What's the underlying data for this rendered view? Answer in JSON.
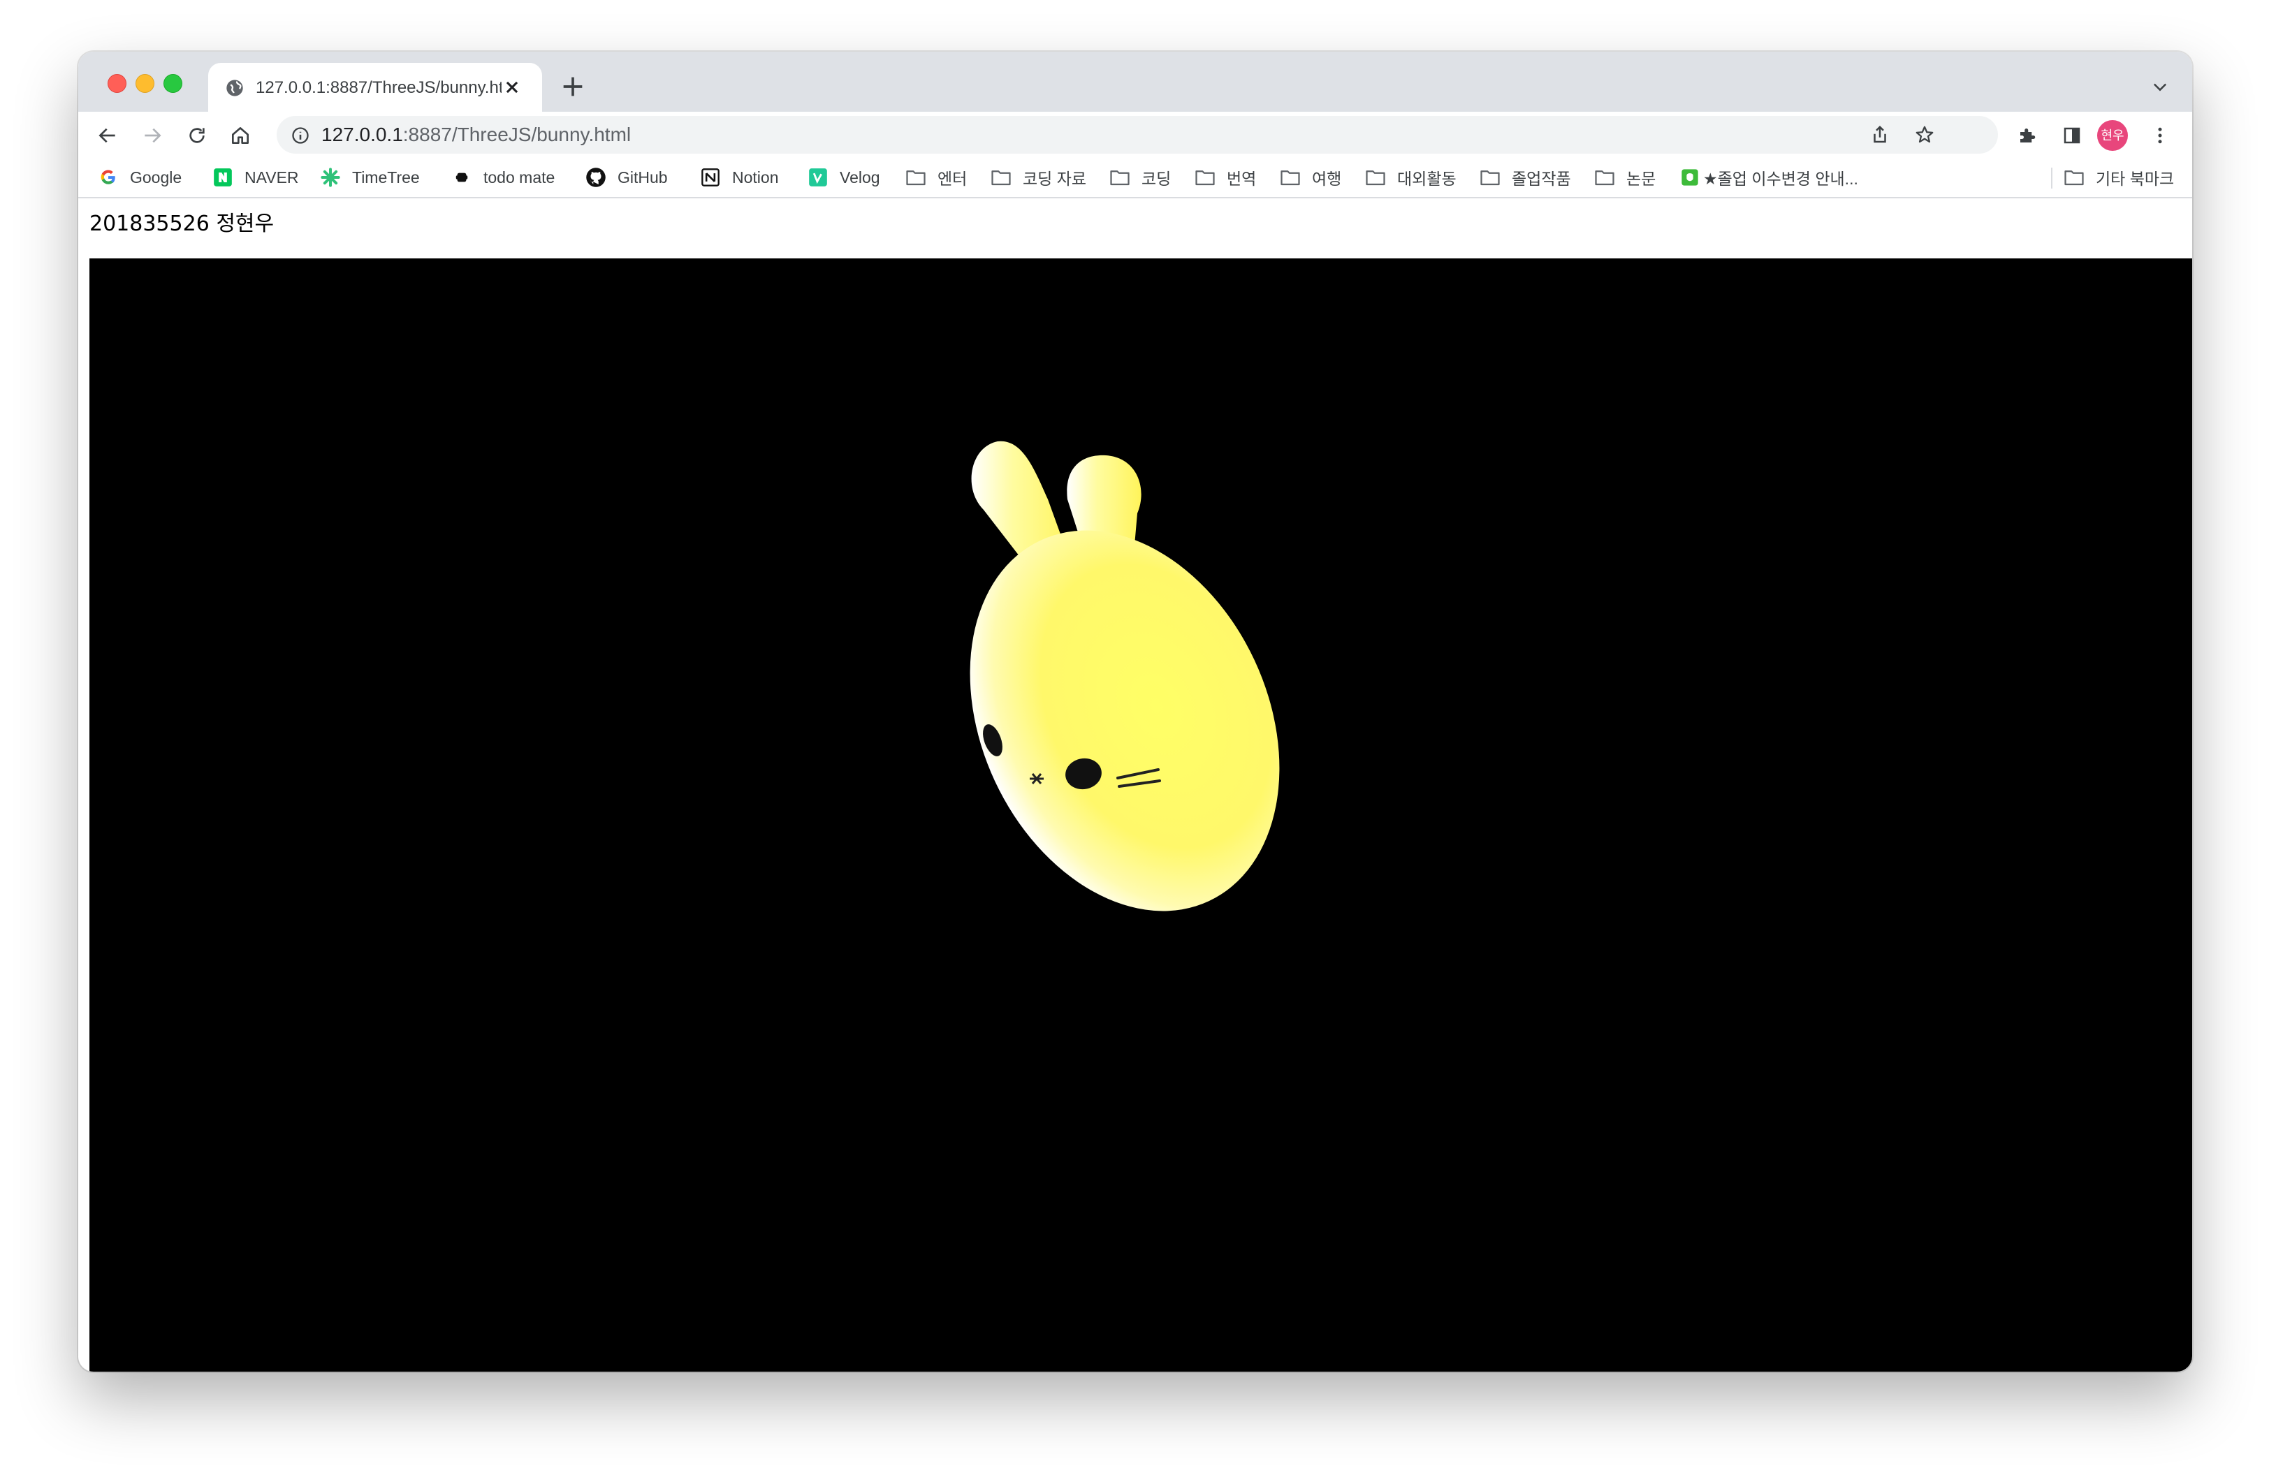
{
  "browser": {
    "tab": {
      "title": "127.0.0.1:8887/ThreeJS/bunny.html",
      "favicon": "globe-icon"
    },
    "address_bar": {
      "host": "127.0.0.1",
      "path": ":8887/ThreeJS/bunny.html"
    },
    "profile_initials": "현우",
    "bookmarks": [
      {
        "label": "Google",
        "icon": "google-icon"
      },
      {
        "label": "NAVER",
        "icon": "naver-icon"
      },
      {
        "label": "TimeTree",
        "icon": "timetree-icon"
      },
      {
        "label": "todo mate",
        "icon": "todomate-icon"
      },
      {
        "label": "GitHub",
        "icon": "github-icon"
      },
      {
        "label": "Notion",
        "icon": "notion-icon"
      },
      {
        "label": "Velog",
        "icon": "velog-icon"
      },
      {
        "label": "엔터",
        "icon": "folder-icon"
      },
      {
        "label": "코딩 자료",
        "icon": "folder-icon"
      },
      {
        "label": "코딩",
        "icon": "folder-icon"
      },
      {
        "label": "번역",
        "icon": "folder-icon"
      },
      {
        "label": "여행",
        "icon": "folder-icon"
      },
      {
        "label": "대외활동",
        "icon": "folder-icon"
      },
      {
        "label": "졸업작품",
        "icon": "folder-icon"
      },
      {
        "label": "논문",
        "icon": "folder-icon"
      },
      {
        "label": "★졸업 이수변경 안내...",
        "icon": "green-doc-icon"
      }
    ],
    "other_bookmarks": "기타 북마크"
  },
  "page": {
    "caption": "201835526 정현우",
    "scene": {
      "background": "#000000",
      "bunny_color": "#ffff6e",
      "object": "bunny-model"
    }
  }
}
